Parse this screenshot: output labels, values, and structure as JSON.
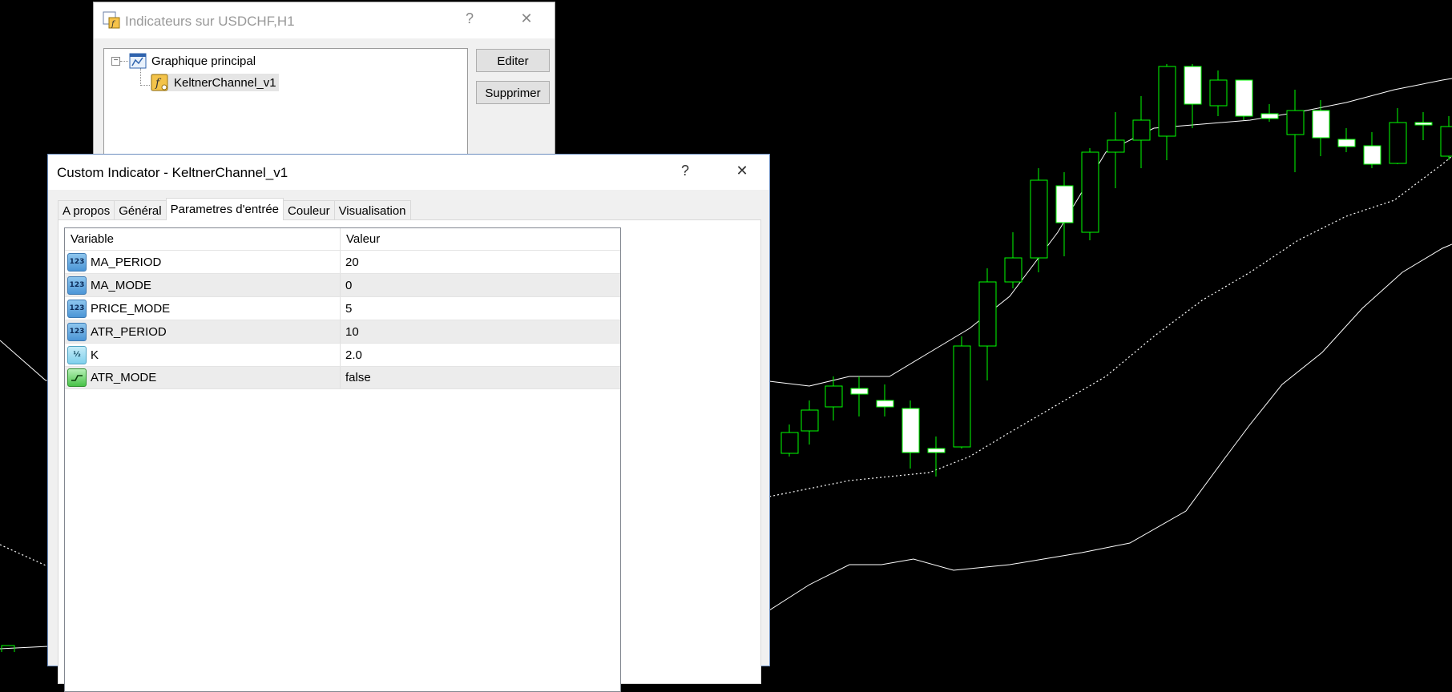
{
  "chart": {
    "background": "#000000",
    "candle_color": "#00ff00",
    "band_color": "#ffffff"
  },
  "indicators_window": {
    "title": "Indicateurs sur USDCHF,H1",
    "help_glyph": "?",
    "close_glyph": "✕",
    "tree": {
      "root_label": "Graphique principal",
      "child_label": "KeltnerChannel_v1"
    },
    "buttons": {
      "edit": "Editer",
      "delete": "Supprimer"
    }
  },
  "custom_indicator_window": {
    "title": "Custom Indicator - KeltnerChannel_v1",
    "help_glyph": "?",
    "close_glyph": "✕",
    "tabs": [
      {
        "label": "A propos"
      },
      {
        "label": "Général"
      },
      {
        "label": "Parametres d'entrée",
        "active": true
      },
      {
        "label": "Couleur"
      },
      {
        "label": "Visualisation"
      }
    ],
    "table": {
      "headers": {
        "variable": "Variable",
        "value": "Valeur"
      },
      "rows": [
        {
          "name": "MA_PERIOD",
          "value": "20",
          "icon": "int-icon",
          "icon_text": "123"
        },
        {
          "name": "MA_MODE",
          "value": "0",
          "icon": "int-icon",
          "icon_text": "123"
        },
        {
          "name": "PRICE_MODE",
          "value": "5",
          "icon": "int-icon",
          "icon_text": "123"
        },
        {
          "name": "ATR_PERIOD",
          "value": "10",
          "icon": "int-icon",
          "icon_text": "123"
        },
        {
          "name": "K",
          "value": "2.0",
          "icon": "double-icon",
          "icon_text": "½"
        },
        {
          "name": "ATR_MODE",
          "value": "false",
          "icon": "bool-icon",
          "icon_text": ""
        }
      ]
    }
  }
}
